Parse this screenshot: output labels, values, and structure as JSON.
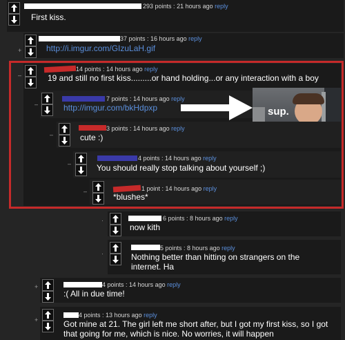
{
  "comments": [
    {
      "points": "293 points",
      "time": "21 hours ago",
      "reply": "reply",
      "text": "First kiss.",
      "collapse": ""
    },
    {
      "points": "37 points",
      "time": "16 hours ago",
      "reply": "reply",
      "text": "http://i.imgur.com/GIzuLaH.gif",
      "collapse": "+"
    },
    {
      "points": "14 points",
      "time": "14 hours ago",
      "reply": "reply",
      "text": "19 and still no first kiss.........or hand holding...or any interaction with a boy",
      "collapse": "–"
    },
    {
      "points": "7 points",
      "time": "14 hours ago",
      "reply": "reply",
      "text": "http://imgur.com/bkHdpxp",
      "collapse": "–"
    },
    {
      "points": "3 points",
      "time": "14 hours ago",
      "reply": "reply",
      "text": "cute :)",
      "collapse": "–"
    },
    {
      "points": "4 points",
      "time": "14 hours ago",
      "reply": "reply",
      "text": "You should really stop talking about yourself ;)",
      "collapse": "–"
    },
    {
      "points": "1 point",
      "time": "14 hours ago",
      "reply": "reply",
      "text": "*blushes*",
      "collapse": "–"
    },
    {
      "points": "6 points",
      "time": "8 hours ago",
      "reply": "reply",
      "text": "now kith",
      "collapse": "·"
    },
    {
      "points": "5 points",
      "time": "8 hours ago",
      "reply": "reply",
      "text": "Nothing better than hitting on strangers on the internet. Ha",
      "collapse": "·"
    },
    {
      "points": "4 points",
      "time": "14 hours ago",
      "reply": "reply",
      "text": ":( All in due time!",
      "collapse": "+"
    },
    {
      "points": "4 points",
      "time": "13 hours ago",
      "reply": "reply",
      "text": "Got mine at 21. The girl left me short after, but I got my first kiss, so I got that going for me, which is nice. No worries, it will happen",
      "collapse": "+"
    }
  ],
  "meme_image": {
    "caption": "sup."
  },
  "colors": {
    "highlight": "#c62a2a",
    "link": "#5b8fdc",
    "background": "#252525",
    "comment_bg": "#1a1a1a"
  },
  "icons": {
    "upvote": "up-arrow-icon",
    "downvote": "down-arrow-icon"
  }
}
